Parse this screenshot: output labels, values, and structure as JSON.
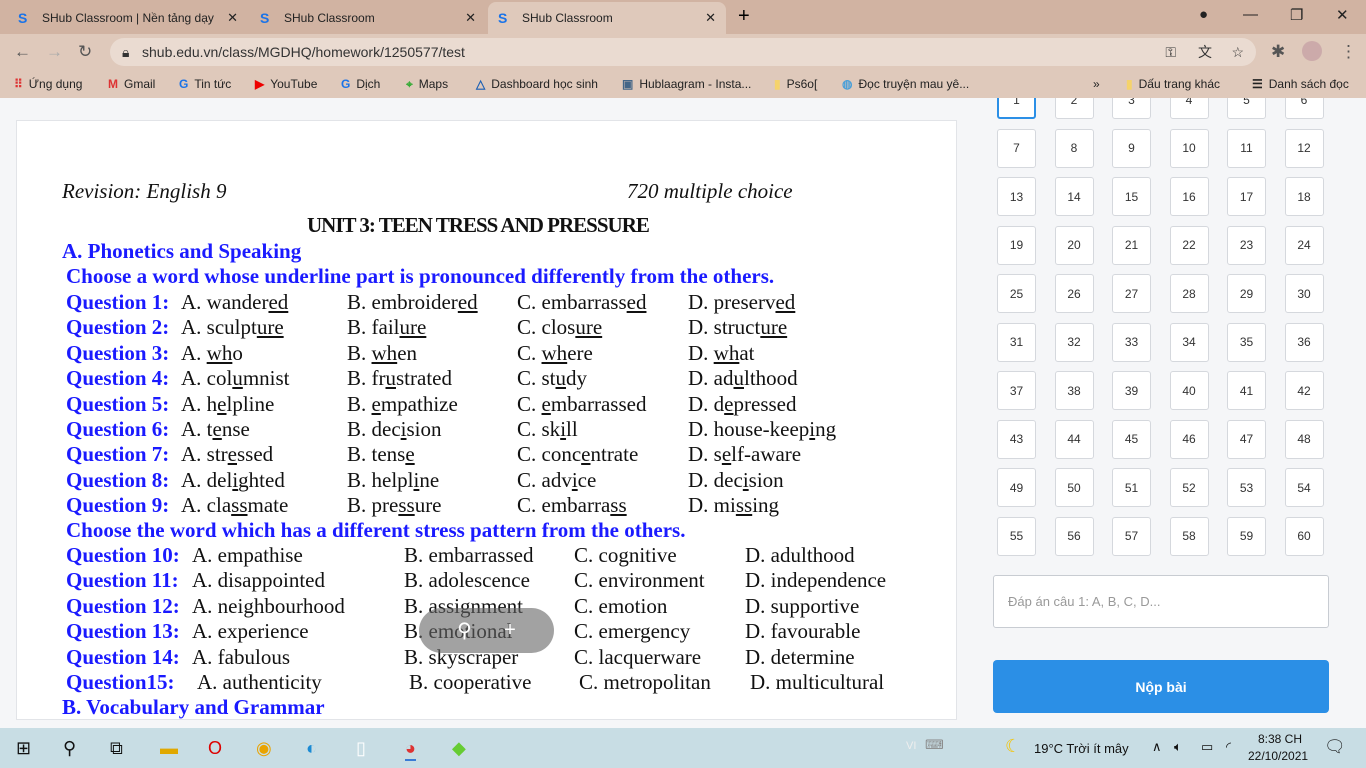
{
  "browser": {
    "tabs": [
      {
        "title": "SHub Classroom | Nền tảng dạy học"
      },
      {
        "title": "SHub Classroom"
      },
      {
        "title": "SHub Classroom"
      }
    ],
    "url": "shub.edu.vn/class/MGDHQ/homework/1250577/test",
    "bookmarks": [
      "Ứng dụng",
      "Gmail",
      "Tin tức",
      "YouTube",
      "Dịch",
      "Maps",
      "Dashboard học sinh",
      "Hublaagram - Insta...",
      "Ps6o[",
      "Đọc truyện mau yê..."
    ],
    "other_bookmarks": "Dấu trang khác",
    "reading_list": "Danh sách đọc"
  },
  "doc": {
    "header_left": "Revision: English 9",
    "header_right": "720 multiple choice",
    "title": "UNIT 3: TEEN TRESS AND PRESSURE",
    "section_a": "A. Phonetics and Speaking",
    "instr1": "Choose a word whose underline part is pronounced differently from the others.",
    "phonetics": [
      {
        "label": "Question 1:",
        "opts": [
          [
            "A. wander",
            "ed",
            ""
          ],
          [
            "B. embroider",
            "ed",
            ""
          ],
          [
            "C. embarrass",
            "ed",
            ""
          ],
          [
            "D. preserv",
            "ed",
            ""
          ]
        ]
      },
      {
        "label": "Question 2:",
        "opts": [
          [
            "A. sculpt",
            "ure",
            ""
          ],
          [
            "B. fail",
            "ure",
            ""
          ],
          [
            "C. clos",
            "ure",
            ""
          ],
          [
            "D. struct",
            "ure",
            ""
          ]
        ]
      },
      {
        "label": "Question 3:",
        "opts": [
          [
            "A. ",
            "wh",
            "o"
          ],
          [
            "B. ",
            "wh",
            "en"
          ],
          [
            "C. ",
            "wh",
            "ere"
          ],
          [
            "D. ",
            "wh",
            "at"
          ]
        ]
      },
      {
        "label": "Question 4:",
        "opts": [
          [
            "A. col",
            "u",
            "mnist"
          ],
          [
            "B. fr",
            "u",
            "strated"
          ],
          [
            "C. st",
            "u",
            "dy"
          ],
          [
            "D. ad",
            "u",
            "lthood"
          ]
        ]
      },
      {
        "label": "Question 5:",
        "opts": [
          [
            "A. h",
            "e",
            "lpline"
          ],
          [
            "B. ",
            "e",
            "mpathize"
          ],
          [
            "C. ",
            "e",
            "mbarrassed"
          ],
          [
            "D. d",
            "e",
            "pressed"
          ]
        ]
      },
      {
        "label": "Question 6:",
        "opts": [
          [
            "A. t",
            "e",
            "nse"
          ],
          [
            "B. dec",
            "i",
            "sion"
          ],
          [
            "C. sk",
            "i",
            "ll"
          ],
          [
            "D. house-keep",
            "i",
            "ng"
          ]
        ]
      },
      {
        "label": "Question 7:",
        "opts": [
          [
            "A. str",
            "e",
            "ssed"
          ],
          [
            "B. tens",
            "e",
            ""
          ],
          [
            "C. conc",
            "e",
            "ntrate"
          ],
          [
            "D. s",
            "e",
            "lf-aware"
          ]
        ]
      },
      {
        "label": "Question 8:",
        "opts": [
          [
            "A. del",
            "i",
            "ghted"
          ],
          [
            "B. helpl",
            "i",
            "ne"
          ],
          [
            "C. adv",
            "i",
            "ce"
          ],
          [
            "D. dec",
            "i",
            "sion"
          ]
        ]
      },
      {
        "label": "Question 9:",
        "opts": [
          [
            "A. cla",
            "ss",
            "mate"
          ],
          [
            "B. pre",
            "ss",
            "ure"
          ],
          [
            "C. embarra",
            "ss",
            ""
          ],
          [
            "D. mi",
            "ss",
            "ing"
          ]
        ]
      }
    ],
    "instr2": "Choose the word which has a different stress pattern from the others.",
    "stress": [
      {
        "label": "Question 10:",
        "opts": [
          "A. empathise",
          "B. embarrassed",
          "C. cognitive",
          "D. adulthood"
        ]
      },
      {
        "label": "Question 11:",
        "opts": [
          "A. disappointed",
          "B. adolescence",
          "C. environment",
          "D. independence"
        ]
      },
      {
        "label": "Question 12:",
        "opts": [
          "A. neighbourhood",
          "B. assignment",
          "C. emotion",
          "D. supportive"
        ]
      },
      {
        "label": "Question 13:",
        "opts": [
          "A. experience",
          "B. emotional",
          "C. emergency",
          "D. favourable"
        ]
      },
      {
        "label": "Question 14:",
        "opts": [
          "A. fabulous",
          "B. skyscraper",
          "C. lacquerware",
          "D. determine"
        ]
      },
      {
        "label": "Question15:",
        "opts": [
          "A. authenticity",
          "B. cooperative",
          "C. metropolitan",
          "D. multicultural"
        ]
      }
    ],
    "section_b": "B. Vocabulary and Grammar"
  },
  "panel": {
    "question_count": 60,
    "current_question": 1,
    "answer_placeholder": "Đáp án câu 1: A, B, C, D...",
    "submit_label": "Nộp bài"
  },
  "taskbar": {
    "lang": "VI",
    "weather": "19°C  Trời ít mây",
    "time": "8:38 CH",
    "date": "22/10/2021"
  },
  "colors": {
    "accent": "#2b8fe6",
    "question_blue": "#1a1aff"
  }
}
